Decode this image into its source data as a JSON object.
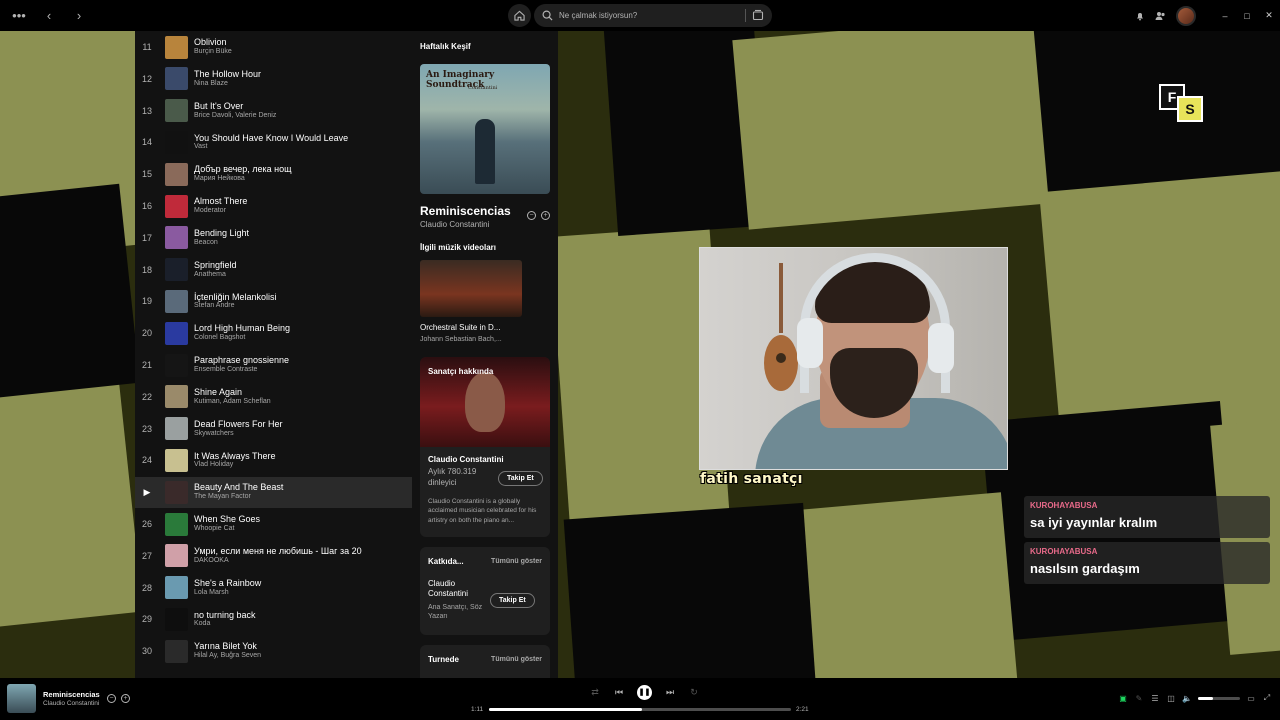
{
  "search": {
    "placeholder": "Ne çalmak istiyorsun?"
  },
  "tracks": [
    {
      "num": "11",
      "title": "Oblivion",
      "artist": "Burçin Büke",
      "color": "#b8843c"
    },
    {
      "num": "12",
      "title": "The Hollow Hour",
      "artist": "Nina Blaze",
      "color": "#3a4a6a"
    },
    {
      "num": "13",
      "title": "But It's Over",
      "artist": "Brice Davoli, Valerie Deniz",
      "color": "#4a5a4a"
    },
    {
      "num": "14",
      "title": "You Should Have Know I Would Leave",
      "artist": "Vast",
      "color": "#111111"
    },
    {
      "num": "15",
      "title": "Добър вечер, лека нощ",
      "artist": "Мария Нейкова",
      "color": "#8a6a5a"
    },
    {
      "num": "16",
      "title": "Almost There",
      "artist": "Moderator",
      "color": "#c02a3a"
    },
    {
      "num": "17",
      "title": "Bending Light",
      "artist": "Beacon",
      "color": "#8a5aa0"
    },
    {
      "num": "18",
      "title": "Springfield",
      "artist": "Anathema",
      "color": "#1a1f2a"
    },
    {
      "num": "19",
      "title": "İçtenliğin Melankolisi",
      "artist": "Stefan Andre",
      "color": "#5a6a7a"
    },
    {
      "num": "20",
      "title": "Lord High Human Being",
      "artist": "Colonel Bagshot",
      "color": "#2a3aa0"
    },
    {
      "num": "21",
      "title": "Paraphrase gnossienne",
      "artist": "Ensemble Contraste",
      "color": "#151515"
    },
    {
      "num": "22",
      "title": "Shine Again",
      "artist": "Kutiman, Adam Scheflan",
      "color": "#9a8a6a"
    },
    {
      "num": "23",
      "title": "Dead Flowers For Her",
      "artist": "Skywatchers",
      "color": "#9aa0a0"
    },
    {
      "num": "24",
      "title": "It Was Always There",
      "artist": "Vlad Holiday",
      "color": "#c8c090"
    },
    {
      "num": "▶",
      "title": "Beauty And The Beast",
      "artist": "The Mayan Factor",
      "color": "#3a2a2a",
      "active": true
    },
    {
      "num": "26",
      "title": "When She Goes",
      "artist": "Whoopie Cat",
      "color": "#2a7a3a"
    },
    {
      "num": "27",
      "title": "Умри, если меня не любишь - Шаг за 20",
      "artist": "DAKOOKA",
      "color": "#d0a0a8"
    },
    {
      "num": "28",
      "title": "She's a Rainbow",
      "artist": "Lola Marsh",
      "color": "#6a9ab0"
    },
    {
      "num": "29",
      "title": "no turning back",
      "artist": "Koda",
      "color": "#0e0e0e"
    },
    {
      "num": "30",
      "title": "Yarına Bilet Yok",
      "artist": "Hilal Ay, Buğra Seven",
      "color": "#2a2a2a"
    }
  ],
  "nowplaying": {
    "playlist": "Haftalık Keşif",
    "cover_title": "An Imaginary Soundtrack",
    "cover_artist": "Constantini",
    "title": "Reminiscencias",
    "artist": "Claudio Constantini",
    "mv_header": "İlgili müzik videoları",
    "video_title": "Orchestral Suite in D...",
    "video_artist": "Johann Sebastian Bach,...",
    "about_header": "Sanatçı hakkında",
    "about_name": "Claudio Constantini",
    "about_listeners": "Aylık 780.319 dinleyici",
    "follow": "Takip Et",
    "about_bio": "Claudio Constantini is a globally acclaimed musician celebrated for his artistry on both the piano an...",
    "contrib_header": "Katkıda...",
    "show_all": "Tümünü göster",
    "contrib_name": "Claudio Constantini",
    "contrib_role": "Ana Sanatçı, Söz Yazarı",
    "tour_header": "Turnede"
  },
  "stream": {
    "caption": "fatih sanatçı",
    "logo_f": "F",
    "logo_s": "S"
  },
  "chat": [
    {
      "user": "KUROHAYABUSA",
      "message": "sa iyi yayınlar kralım"
    },
    {
      "user": "KUROHAYABUSA",
      "message": "nasılsın gardaşım"
    }
  ],
  "player": {
    "title": "Reminiscencias",
    "artist": "Claudio Constantini",
    "elapsed": "1:11",
    "total": "2:21",
    "progress": 0.505,
    "volume": 0.35
  },
  "colors": {
    "accent": "#1ed760",
    "chat_user": "#e86a8a"
  }
}
